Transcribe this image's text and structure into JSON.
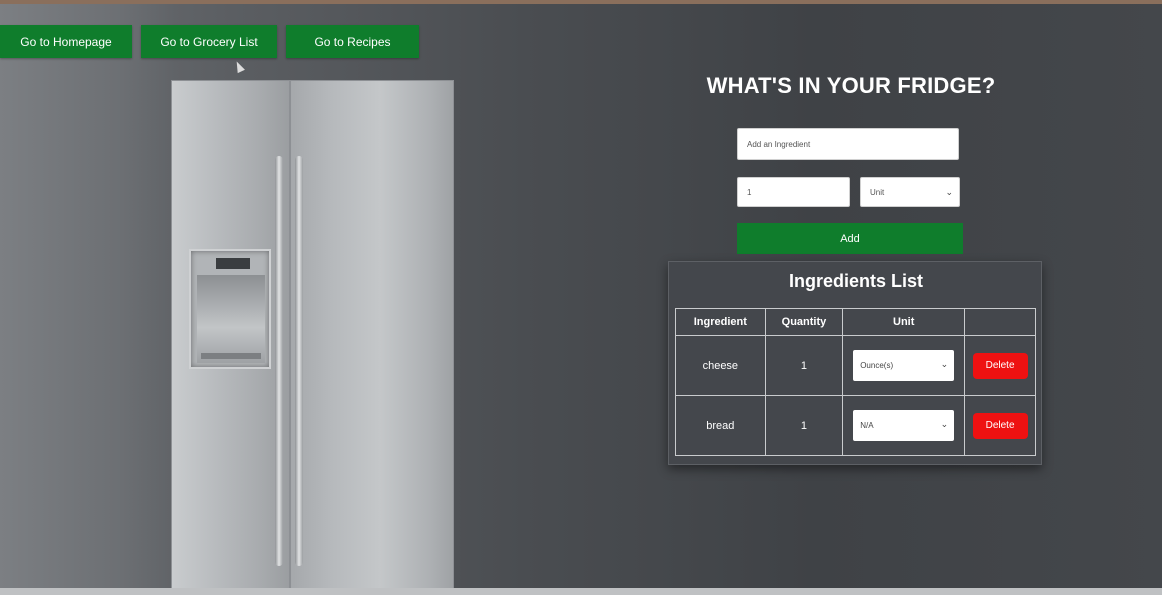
{
  "nav": {
    "home_label": "Go to Homepage",
    "grocery_label": "Go to Grocery List",
    "recipes_label": "Go to Recipes"
  },
  "form": {
    "title": "WHAT'S IN YOUR FRIDGE?",
    "ingredient_placeholder": "Add an Ingredient",
    "quantity_value": "1",
    "unit_value": "Unit",
    "add_label": "Add"
  },
  "ingredients": {
    "title": "Ingredients List",
    "headers": [
      "Ingredient",
      "Quantity",
      "Unit",
      ""
    ],
    "rows": [
      {
        "name": "cheese",
        "quantity": "1",
        "unit": "Ounce(s)",
        "delete_label": "Delete"
      },
      {
        "name": "bread",
        "quantity": "1",
        "unit": "N/A",
        "delete_label": "Delete"
      }
    ]
  },
  "colors": {
    "button_green": "#0f7d2c",
    "delete_red": "#ee1111",
    "background": "#44474b"
  }
}
